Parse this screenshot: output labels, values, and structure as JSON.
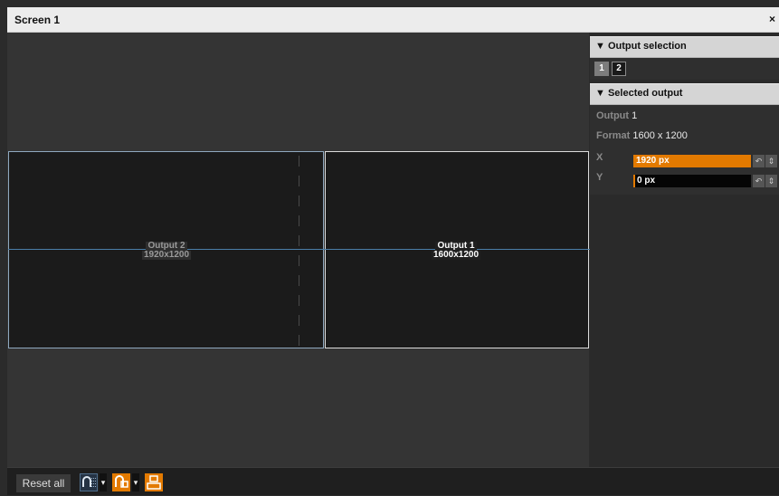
{
  "window": {
    "title": "Screen 1",
    "close_glyph": "×"
  },
  "canvas": {
    "outputs": [
      {
        "name": "Output 2",
        "resolution": "1920x1200"
      },
      {
        "name": "Output 1",
        "resolution": "1600x1200"
      }
    ]
  },
  "panel": {
    "output_selection": {
      "header": "▼ Output selection",
      "buttons": [
        "1",
        "2"
      ],
      "selected": "1"
    },
    "selected_output": {
      "header": "▼ Selected output",
      "output_label": "Output",
      "output_value": "1",
      "format_label": "Format",
      "format_value": "1600 x 1200",
      "x_label": "X",
      "x_value": "1920 px",
      "y_label": "Y",
      "y_value": "0 px"
    }
  },
  "toolbar": {
    "reset_label": "Reset all",
    "dropdown_glyph": "▾"
  },
  "colors": {
    "accent": "#e37a00",
    "canvas_bg": "#343434",
    "monitor_bg": "#1b1b1b"
  }
}
